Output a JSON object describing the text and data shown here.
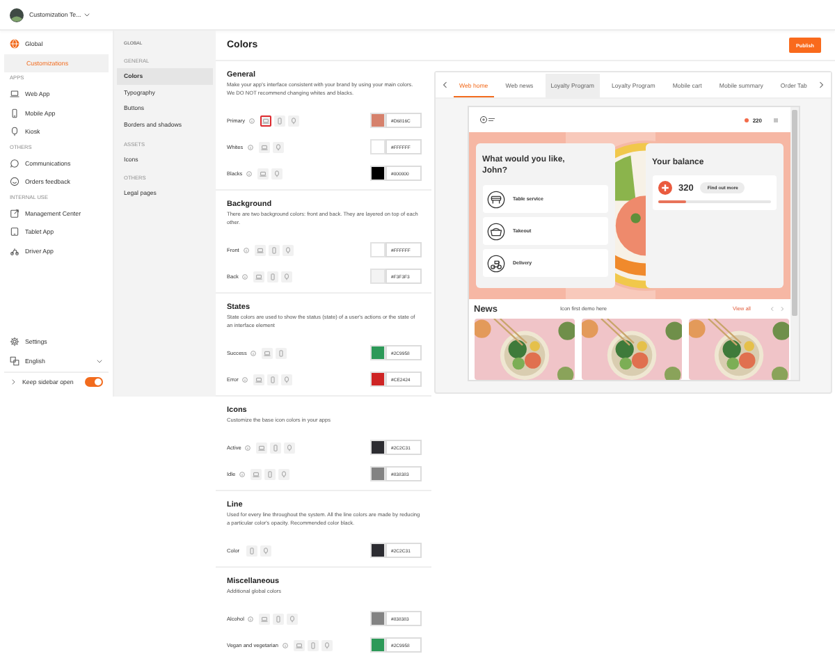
{
  "header": {
    "workspace": "Customization Te..."
  },
  "sidebar": {
    "items": [
      {
        "label": "Global",
        "selected": false,
        "expanded": true,
        "children": [
          {
            "label": "Customizations",
            "selected": true
          }
        ]
      }
    ],
    "groups": [
      {
        "heading": "APPS",
        "items": [
          {
            "label": "Web App",
            "selected": false
          },
          {
            "label": "Mobile App",
            "selected": false
          },
          {
            "label": "Kiosk",
            "selected": false
          }
        ]
      },
      {
        "heading": "OTHERS",
        "items": [
          {
            "label": "Communications",
            "selected": false
          },
          {
            "label": "Orders feedback",
            "selected": false
          }
        ]
      },
      {
        "heading": "INTERNAL USE",
        "items": [
          {
            "label": "Management Center",
            "selected": false
          },
          {
            "label": "Tablet App",
            "selected": false
          },
          {
            "label": "Driver App",
            "selected": false
          }
        ]
      }
    ],
    "settings": "Settings",
    "language": "English",
    "keep_open": {
      "label": "Keep sidebar open",
      "on": true
    }
  },
  "subnav": {
    "title": "GLOBAL",
    "groups": [
      {
        "heading": "GENERAL",
        "items": [
          {
            "label": "Colors",
            "selected": true
          },
          {
            "label": "Typography",
            "selected": false
          },
          {
            "label": "Buttons",
            "selected": false
          },
          {
            "label": "Borders and shadows",
            "selected": false
          }
        ]
      },
      {
        "heading": "ASSETS",
        "items": [
          {
            "label": "Icons",
            "selected": false
          }
        ]
      },
      {
        "heading": "OTHERS",
        "items": [
          {
            "label": "Legal pages",
            "selected": false
          }
        ]
      }
    ]
  },
  "page": {
    "title": "Colors",
    "publish": "Publish"
  },
  "sections": [
    {
      "title": "General",
      "description": "Make your app's interface consistent with your brand by using your main colors. We DO NOT recommend changing whites and blacks.",
      "rows": [
        {
          "label": "Primary",
          "info": true,
          "devices": [
            {
              "kind": "laptop",
              "highlighted": true
            },
            {
              "kind": "phone",
              "highlighted": false
            },
            {
              "kind": "kiosk",
              "highlighted": false
            }
          ],
          "color": "#d6816c",
          "hex": "#D6816C"
        },
        {
          "label": "Whites",
          "info": true,
          "devices": [
            {
              "kind": "laptop",
              "highlighted": false
            },
            {
              "kind": "kiosk",
              "highlighted": false
            }
          ],
          "color": "#ffffff",
          "hex": "#FFFFFF"
        },
        {
          "label": "Blacks",
          "info": true,
          "devices": [
            {
              "kind": "laptop",
              "highlighted": false
            },
            {
              "kind": "kiosk",
              "highlighted": false
            }
          ],
          "color": "#000000",
          "hex": "#000000"
        }
      ]
    },
    {
      "title": "Background",
      "description": "There are two background colors: front and back. They are layered on top of each other.",
      "rows": [
        {
          "label": "Front",
          "info": true,
          "devices": [
            {
              "kind": "laptop",
              "highlighted": false
            },
            {
              "kind": "phone",
              "highlighted": false
            },
            {
              "kind": "kiosk",
              "highlighted": false
            }
          ],
          "color": "#ffffff",
          "hex": "#FFFFFF"
        },
        {
          "label": "Back",
          "info": true,
          "devices": [
            {
              "kind": "laptop",
              "highlighted": false
            },
            {
              "kind": "phone",
              "highlighted": false
            },
            {
              "kind": "kiosk",
              "highlighted": false
            }
          ],
          "color": "#f3f3f3",
          "hex": "#F3F3F3"
        }
      ]
    },
    {
      "title": "States",
      "description": "State colors are used to show the status (state) of a user's actions or the state of an interface element",
      "rows": [
        {
          "label": "Success",
          "info": true,
          "devices": [
            {
              "kind": "laptop",
              "highlighted": false
            },
            {
              "kind": "phone",
              "highlighted": false
            }
          ],
          "color": "#2c9958",
          "hex": "#2C9958"
        },
        {
          "label": "Error",
          "info": true,
          "devices": [
            {
              "kind": "laptop",
              "highlighted": false
            },
            {
              "kind": "phone",
              "highlighted": false
            },
            {
              "kind": "kiosk",
              "highlighted": false
            }
          ],
          "color": "#ce2424",
          "hex": "#CE2424"
        }
      ]
    },
    {
      "title": "Icons",
      "description": "Customize the base icon colors in your apps",
      "rows": [
        {
          "label": "Active",
          "info": true,
          "devices": [
            {
              "kind": "laptop",
              "highlighted": false
            },
            {
              "kind": "phone",
              "highlighted": false
            },
            {
              "kind": "kiosk",
              "highlighted": false
            }
          ],
          "color": "#2c2c31",
          "hex": "#2C2C31"
        },
        {
          "label": "Idle",
          "info": true,
          "devices": [
            {
              "kind": "laptop",
              "highlighted": false
            },
            {
              "kind": "phone",
              "highlighted": false
            },
            {
              "kind": "kiosk",
              "highlighted": false
            }
          ],
          "color": "#838383",
          "hex": "#838383"
        }
      ]
    },
    {
      "title": "Line",
      "description": "Used for every line throughout the system. All the line colors are made by reducing a particular color's opacity. Recommended color black.",
      "rows": [
        {
          "label": "Color",
          "info": false,
          "devices": [
            {
              "kind": "phone",
              "highlighted": false
            },
            {
              "kind": "kiosk",
              "highlighted": false
            }
          ],
          "color": "#2c2c31",
          "hex": "#2C2C31"
        }
      ]
    },
    {
      "title": "Miscellaneous",
      "description": "Additional global colors",
      "rows": [
        {
          "label": "Alcohol",
          "info": true,
          "devices": [
            {
              "kind": "laptop",
              "highlighted": false
            },
            {
              "kind": "phone",
              "highlighted": false
            },
            {
              "kind": "kiosk",
              "highlighted": false
            }
          ],
          "color": "#838383",
          "hex": "#838383"
        },
        {
          "label": "Vegan and vegetarian",
          "info": true,
          "devices": [
            {
              "kind": "laptop",
              "highlighted": false
            },
            {
              "kind": "phone",
              "highlighted": false
            },
            {
              "kind": "kiosk",
              "highlighted": false
            }
          ],
          "color": "#2c9958",
          "hex": "#2C9958"
        }
      ]
    }
  ],
  "preview": {
    "tabs": [
      {
        "label": "Web home",
        "selected": true,
        "highlighted": false
      },
      {
        "label": "Web news",
        "selected": false,
        "highlighted": false
      },
      {
        "label": "Loyalty Program",
        "selected": false,
        "highlighted": true
      },
      {
        "label": "Loyalty Program",
        "selected": false,
        "highlighted": false
      },
      {
        "label": "Mobile cart",
        "selected": false,
        "highlighted": false
      },
      {
        "label": "Mobile summary",
        "selected": false,
        "highlighted": false
      },
      {
        "label": "Order Tab",
        "selected": false,
        "highlighted": false
      }
    ],
    "app": {
      "points": "220",
      "hero": {
        "kind": "picture"
      },
      "greeting": "What would you like, John?",
      "options": [
        "Table service",
        "Takeout",
        "Delivery"
      ],
      "balance": {
        "title": "Your balance",
        "points": "320",
        "button": "Find out more",
        "level": 0.25
      },
      "news": {
        "title": "News",
        "note": "Icon first demo here",
        "link": "View all",
        "items": [
          {
            "kind": "picture"
          },
          {
            "kind": "picture"
          },
          {
            "kind": "picture"
          }
        ]
      }
    }
  }
}
